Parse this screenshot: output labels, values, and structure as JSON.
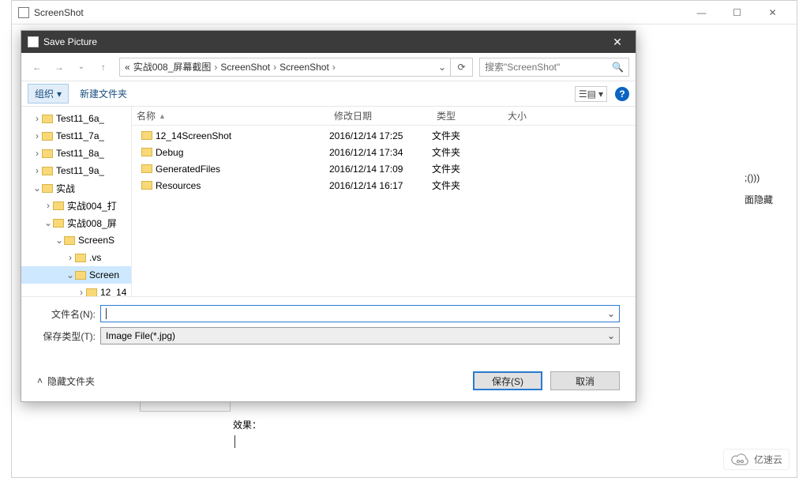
{
  "background": {
    "title": "ScreenShot",
    "code_lines": [
      ";()))",
      "面隐藏"
    ],
    "bottom_caption": "效果："
  },
  "dialog": {
    "title": "Save Picture",
    "breadcrumb": [
      "«",
      "实战008_屏幕截图",
      "ScreenShot",
      "ScreenShot"
    ],
    "search_placeholder": "搜索\"ScreenShot\"",
    "toolbar": {
      "organize": "组织",
      "new_folder": "新建文件夹"
    },
    "tree": [
      {
        "indent": 1,
        "toggle": "›",
        "label": "Test11_6a_"
      },
      {
        "indent": 1,
        "toggle": "›",
        "label": "Test11_7a_"
      },
      {
        "indent": 1,
        "toggle": "›",
        "label": "Test11_8a_"
      },
      {
        "indent": 1,
        "toggle": "›",
        "label": "Test11_9a_"
      },
      {
        "indent": 1,
        "toggle": "⌄",
        "label": "实战"
      },
      {
        "indent": 2,
        "toggle": "›",
        "label": "实战004_打"
      },
      {
        "indent": 2,
        "toggle": "⌄",
        "label": "实战008_屏"
      },
      {
        "indent": 3,
        "toggle": "⌄",
        "label": "ScreenS"
      },
      {
        "indent": 4,
        "toggle": "›",
        "label": ".vs"
      },
      {
        "indent": 4,
        "toggle": "⌄",
        "label": "Screen",
        "active": true
      },
      {
        "indent": 5,
        "toggle": "›",
        "label": "12_14"
      }
    ],
    "columns": {
      "name": "名称",
      "date": "修改日期",
      "type": "类型",
      "size": "大小"
    },
    "rows": [
      {
        "name": "12_14ScreenShot",
        "date": "2016/12/14 17:25",
        "type": "文件夹"
      },
      {
        "name": "Debug",
        "date": "2016/12/14 17:34",
        "type": "文件夹"
      },
      {
        "name": "GeneratedFiles",
        "date": "2016/12/14 17:09",
        "type": "文件夹"
      },
      {
        "name": "Resources",
        "date": "2016/12/14 16:17",
        "type": "文件夹"
      }
    ],
    "filename_label": "文件名(N):",
    "filename_value": "",
    "filetype_label": "保存类型(T):",
    "filetype_value": "Image File(*.jpg)",
    "hide_folders": "隐藏文件夹",
    "save": "保存(S)",
    "cancel": "取消"
  },
  "watermark": "亿速云"
}
